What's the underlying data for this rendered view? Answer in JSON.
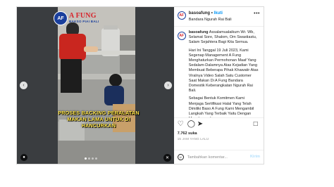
{
  "media": {
    "logo_mark": "AF",
    "logo_text": "A FUNG",
    "logo_sub": "BAKSO PIAI BALI",
    "caption": "PROSES BACKING PERALATAN MAKAN LAMA UNTUK DI HANCURKAN"
  },
  "header": {
    "avatar": "AF",
    "username": "basoafung",
    "separator": "•",
    "follow_label": "Ikuti",
    "location": "Bandara Ngurah Rai Bali"
  },
  "caption": {
    "username": "basoafung",
    "greeting": "Assalamualaikum Wr. Wb, Selamat Sore, Shalom, Om Swastiastu, Salam Sejahtera Bagi Kita Semua.",
    "paragraph_2": "Hari Ini Tanggal 19 Juli 2023, Kami Segenap Management A Fung Menghaturkan Permohonan Maaf Yang Sedalam-Dalamnya Atas Kejadian Yang Membuat Beberapa Pihak Khawatir Atas Viralnya Video Salah Satu Customer Saat Makan Di A Fung Bandara Domestik Keberangkatan Ngurah Rai Bali.",
    "paragraph_3": "Sebagai Bentuk Komitmen Kami Menjaga Sertifikasi Halal Yang Telah Dimiliki Baso A Fung Kami Mengambil Langkah Yang Terbaik Yaitu Dengan Menghancurkan"
  },
  "actions": {
    "likes": "7.762 suka",
    "time": "15 JAM YANG LALU"
  },
  "comment": {
    "placeholder": "Tambahkan komentar...",
    "post_label": "Kirim"
  },
  "icons": {
    "like": "heart-icon",
    "comment": "comment-icon",
    "share": "share-icon",
    "save": "bookmark-icon"
  },
  "colors": {
    "accent": "#0095f6",
    "brand_red": "#d8232a",
    "brand_blue": "#1a3f9c",
    "caption_yellow": "#ffe64a"
  }
}
